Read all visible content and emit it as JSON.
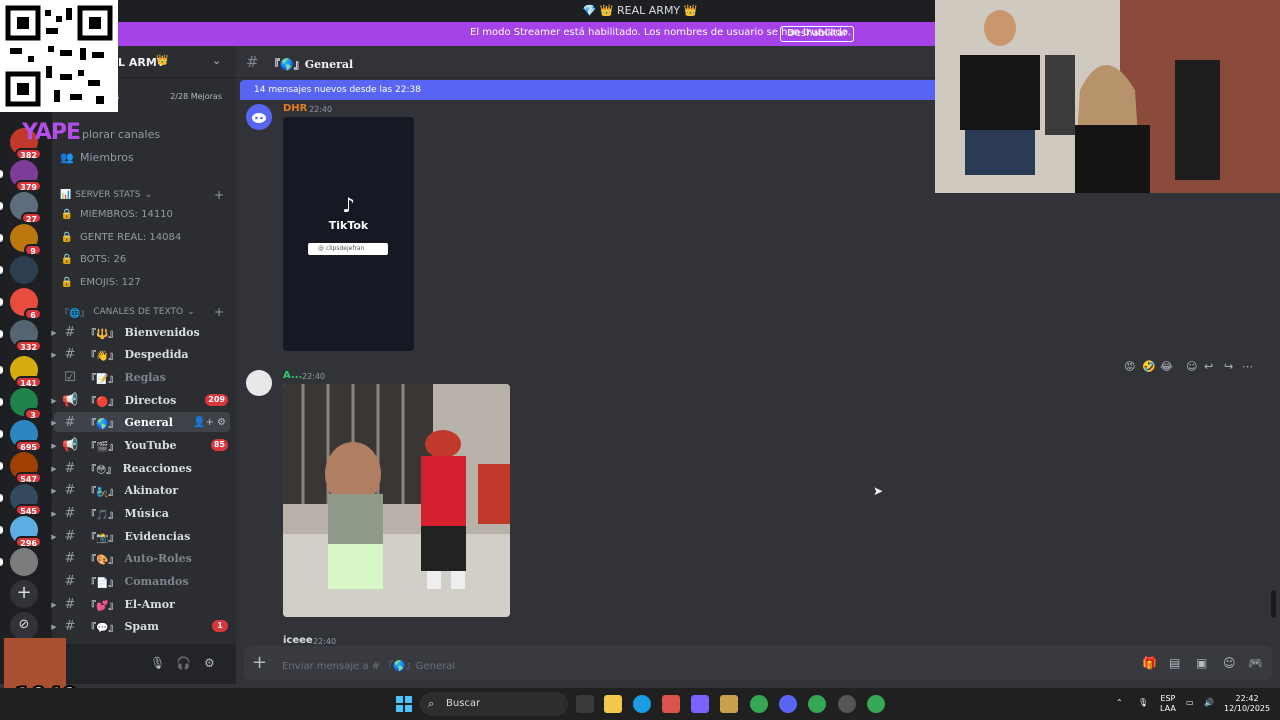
{
  "window_title": "REAL ARMY",
  "streamer_bar": {
    "message": "El modo Streamer está habilitado. Los nombres de usuario se han truncado.",
    "button": "Deshabilitar"
  },
  "server": {
    "name": "L ARMY",
    "boosts_left": "oras",
    "boosts_right": "2/28 Mejoras",
    "explore": "plorar canales",
    "members": "Miembros"
  },
  "guild_badges": [
    "382",
    "379",
    "27",
    "9",
    "",
    "6",
    "332",
    "141",
    "3",
    "695",
    "547",
    "545",
    "296",
    ""
  ],
  "stats_category": "SERVER STATS",
  "stats": [
    "MIEMBROS: 14110",
    "GENTE REAL: 14084",
    "BOTS: 26",
    "EMOJIS: 127"
  ],
  "text_category": "CANALES DE TEXTO",
  "channels": [
    {
      "name": "Bienvenidos",
      "badge": ""
    },
    {
      "name": "Despedida",
      "badge": ""
    },
    {
      "name": "Reglas",
      "badge": ""
    },
    {
      "name": "Directos",
      "badge": "209"
    },
    {
      "name": "General",
      "badge": ""
    },
    {
      "name": "YouTube",
      "badge": "85"
    },
    {
      "name": "Reacciones",
      "badge": ""
    },
    {
      "name": "Akinator",
      "badge": ""
    },
    {
      "name": "Música",
      "badge": ""
    },
    {
      "name": "Evidencias",
      "badge": ""
    },
    {
      "name": "Auto-Roles",
      "badge": ""
    },
    {
      "name": "Comandos",
      "badge": ""
    },
    {
      "name": "El-Amor",
      "badge": ""
    },
    {
      "name": "Spam",
      "badge": "1"
    }
  ],
  "chat": {
    "channel_name": "General",
    "new_messages": "14 mensajes nuevos desde las 22:38",
    "messages": [
      {
        "author": "DHR",
        "time": "22:40",
        "embed_brand": "TikTok",
        "embed_handle": "@ clipsdejefran"
      },
      {
        "author": "A...",
        "time": "22:40"
      },
      {
        "author": "iceee",
        "time": "22:40"
      }
    ],
    "composer_placeholder": "Enviar mensaje a # 『🌎』General"
  },
  "overlay": {
    "yape": "YAPE",
    "number": "x1049",
    "status": "ublado"
  },
  "taskbar": {
    "search": "Buscar",
    "lang_top": "ESP",
    "lang_bottom": "LAA",
    "time": "22:42",
    "date": "12/10/2025"
  },
  "colors": {
    "discord_bg": "#313338",
    "sidebar": "#2b2d31",
    "rail": "#1e1f22",
    "accent": "#5865f2",
    "streamer": "#a543e8",
    "badge": "#da373c"
  }
}
